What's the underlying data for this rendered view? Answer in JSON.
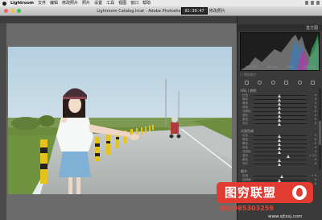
{
  "menubar": {
    "app_name": "Lightroom",
    "items": [
      "文件",
      "编辑",
      "修改照片",
      "照片",
      "设置",
      "工具",
      "视图",
      "窗口",
      "帮助"
    ]
  },
  "window": {
    "title": "Lightroom Catalog.lrcat - Adobe Photoshop Lightroom - 修改照片"
  },
  "timer": "02:39:47",
  "right_panel": {
    "header_label": "直方图",
    "histogram_info": [
      "ISO 100",
      "35 mm",
      "f/1.8",
      "1/320 秒"
    ],
    "original_photo_label": "☐ 原始照片",
    "hsl_section": "HSL / 颜色",
    "split_section": "分离色调",
    "detail_section": "细节",
    "rows_a": [
      {
        "name": "红色",
        "value": "0"
      },
      {
        "name": "橙色",
        "value": "0"
      },
      {
        "name": "黄色",
        "value": "0"
      },
      {
        "name": "绿色",
        "value": "0"
      },
      {
        "name": "浅绿色",
        "value": "0"
      },
      {
        "name": "蓝色",
        "value": "0"
      },
      {
        "name": "紫色",
        "value": "0"
      },
      {
        "name": "洋红",
        "value": "0"
      }
    ],
    "rows_b": [
      {
        "name": "红色",
        "value": "0"
      },
      {
        "name": "橙色",
        "value": "0"
      },
      {
        "name": "黄色",
        "value": "0"
      },
      {
        "name": "绿色",
        "value": "0"
      },
      {
        "name": "浅绿色",
        "value": "0"
      },
      {
        "name": "蓝色",
        "value": "+ 21"
      },
      {
        "name": "紫色",
        "value": "0"
      },
      {
        "name": "洋红",
        "value": "0"
      }
    ],
    "rows_c": [
      {
        "name": "色相",
        "value": "+ 5"
      },
      {
        "name": "饱和度",
        "value": "0"
      },
      {
        "name": "数量",
        "value": "0"
      }
    ]
  },
  "watermark": {
    "brand": "图穷联盟",
    "qq": "QQ:985303259",
    "url": "www.sjtxsj.com"
  }
}
